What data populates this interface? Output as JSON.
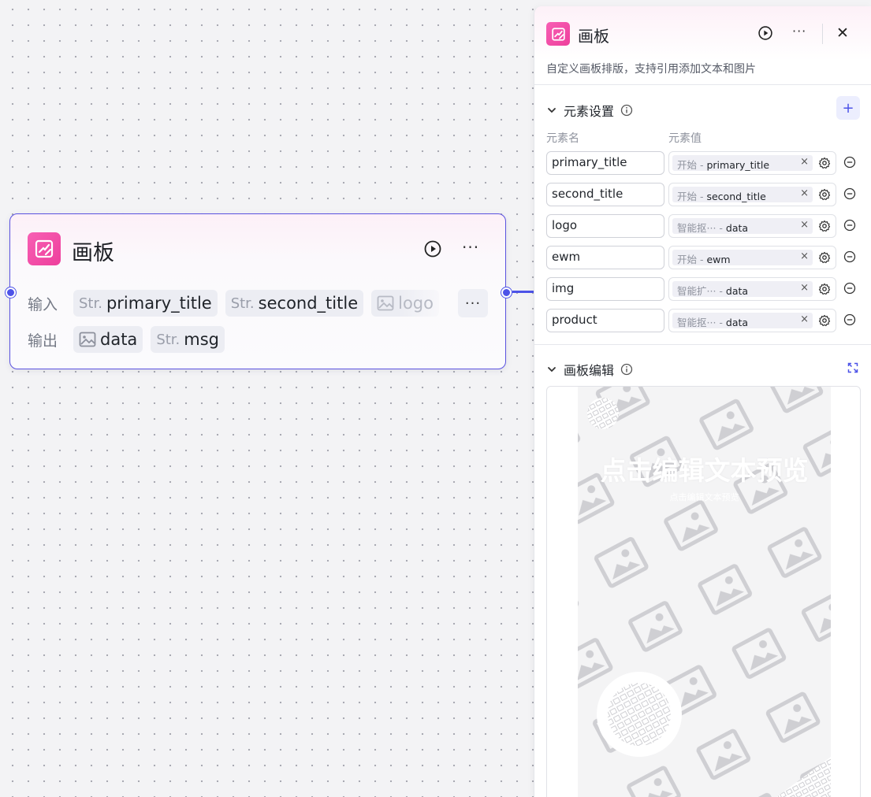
{
  "node": {
    "title": "画板",
    "input_label": "输入",
    "output_label": "输出",
    "inputs": [
      {
        "type": "Str.",
        "name": "primary_title"
      },
      {
        "type": "Str.",
        "name": "second_title"
      },
      {
        "type": "image",
        "name": "logo"
      }
    ],
    "outputs": [
      {
        "type": "image",
        "name": "data"
      },
      {
        "type": "Str.",
        "name": "msg"
      }
    ],
    "more_label": "···",
    "accent": "#4d53e8",
    "icon_color": "#f04ea5"
  },
  "panel": {
    "title": "画板",
    "more_label": "···",
    "close_label": "✕",
    "description": "自定义画板排版，支持引用添加文本和图片",
    "elements_section": {
      "title": "元素设置",
      "add_label": "+",
      "col_name": "元素名",
      "col_value": "元素值",
      "rows": [
        {
          "name": "primary_title",
          "source": "开始",
          "field": "primary_title",
          "truncated": false
        },
        {
          "name": "second_title",
          "source": "开始",
          "field": "second_title",
          "truncated": false
        },
        {
          "name": "logo",
          "source": "智能抠",
          "field": "data",
          "truncated": true
        },
        {
          "name": "ewm",
          "source": "开始",
          "field": "ewm",
          "truncated": false
        },
        {
          "name": "img",
          "source": "智能扩",
          "field": "data",
          "truncated": true
        },
        {
          "name": "product",
          "source": "智能抠",
          "field": "data",
          "truncated": true
        }
      ]
    },
    "editor_section": {
      "title": "画板编辑",
      "preview_title": "点击编辑文本预览",
      "preview_subtitle": "点击编辑文本预览"
    }
  }
}
